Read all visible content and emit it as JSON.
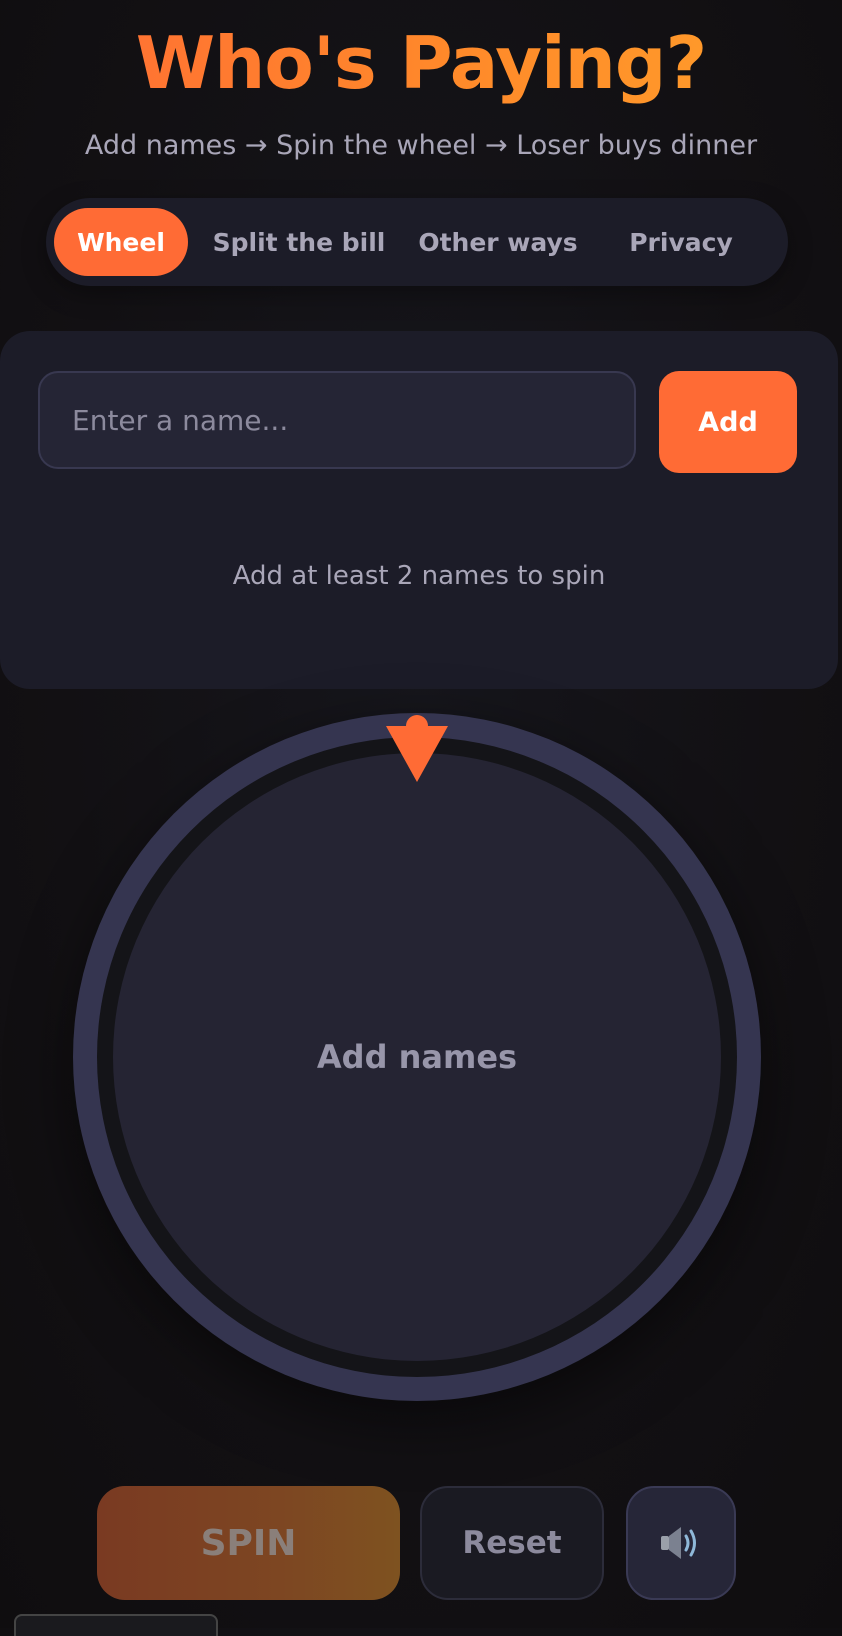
{
  "header": {
    "title": "Who's Paying?",
    "subtitle": "Add names → Spin the wheel → Loser buys dinner"
  },
  "tabs": [
    {
      "label": "Wheel",
      "active": true
    },
    {
      "label": "Split the bill",
      "active": false
    },
    {
      "label": "Other ways",
      "active": false
    },
    {
      "label": "Privacy",
      "active": false
    }
  ],
  "name_entry": {
    "placeholder": "Enter a name...",
    "value": "",
    "add_label": "Add",
    "hint": "Add at least 2 names to spin"
  },
  "wheel": {
    "empty_label": "Add names"
  },
  "controls": {
    "spin_label": "SPIN",
    "reset_label": "Reset",
    "sound_icon": "speaker-icon"
  },
  "colors": {
    "accent": "#ff6b35",
    "panel": "#1c1c28",
    "background": "#121013"
  }
}
